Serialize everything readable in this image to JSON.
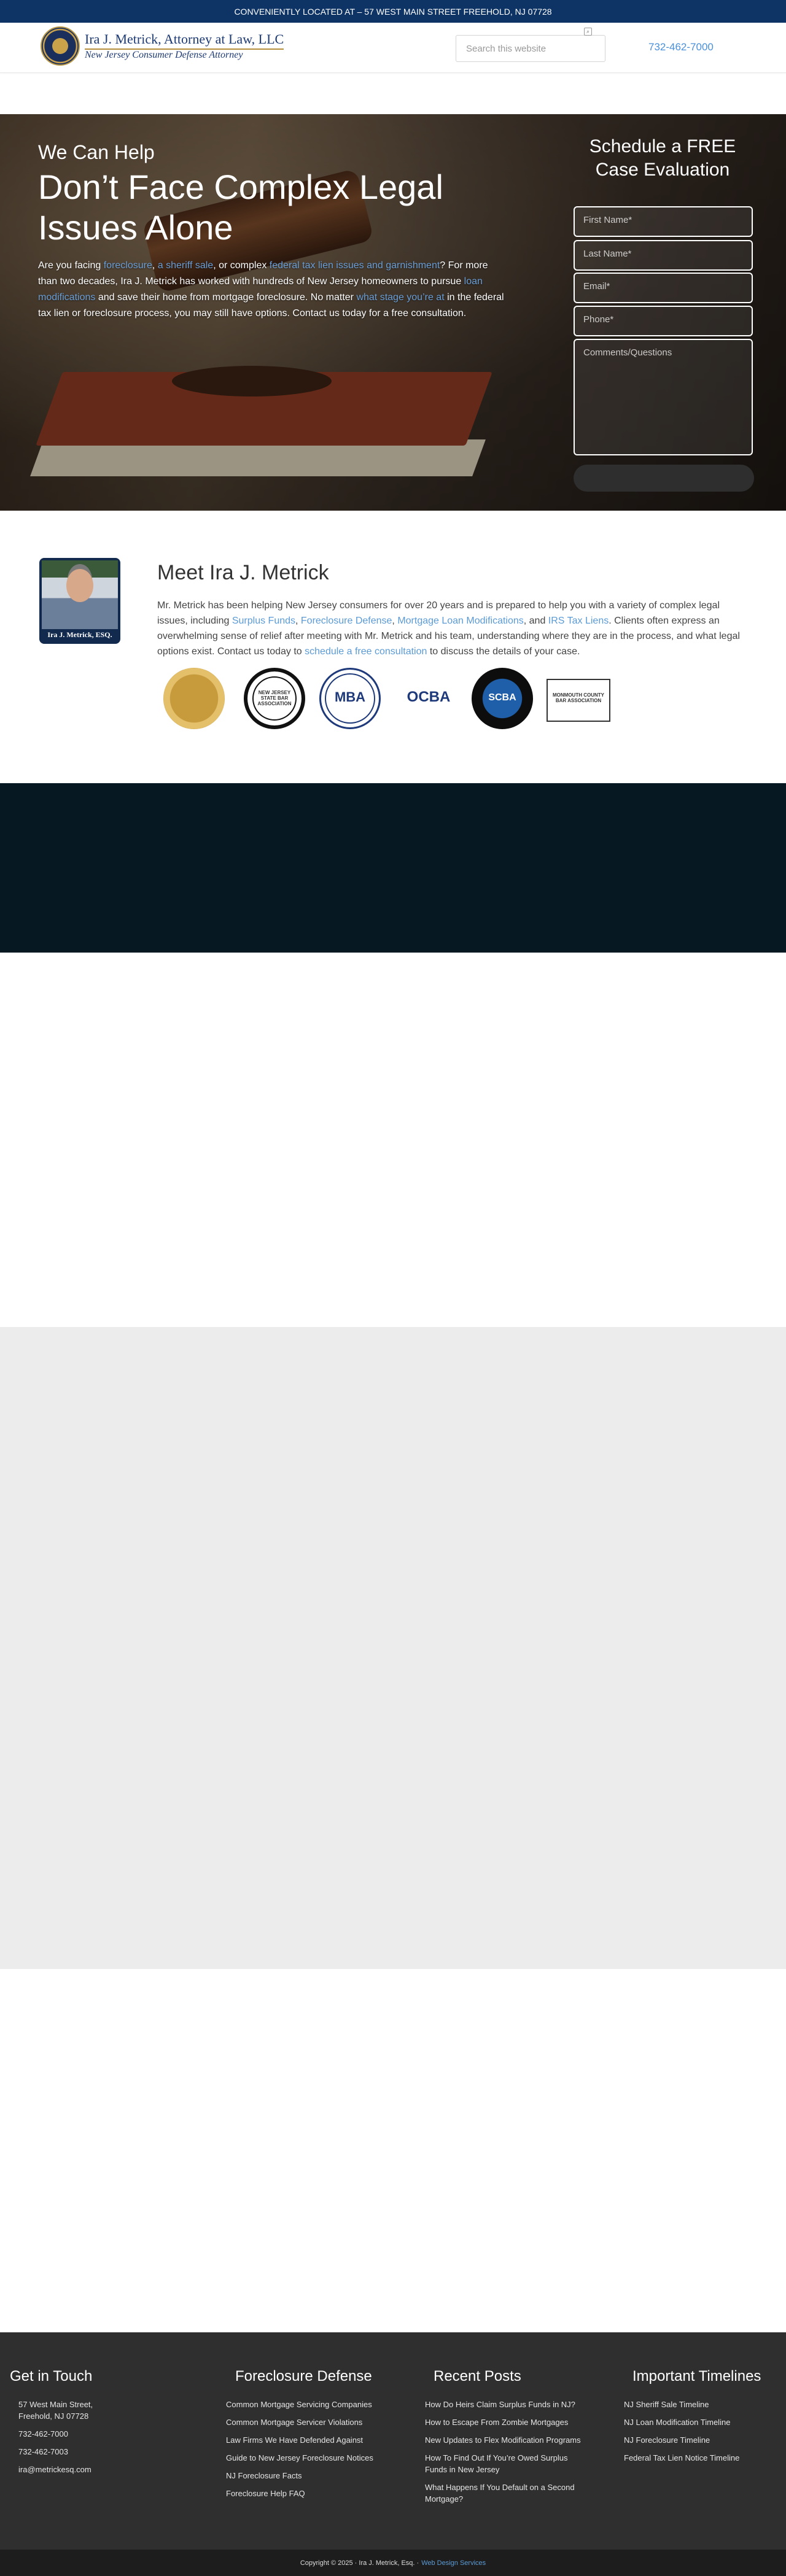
{
  "topbar": {
    "text": "CONVENIENTLY LOCATED AT – 57 WEST MAIN STREET FREEHOLD, NJ 07728"
  },
  "header": {
    "logo_name": "Ira J. Metrick, Attorney at Law, LLC",
    "logo_tagline": "New Jersey Consumer Defense Attorney",
    "search_placeholder": "Search this website",
    "phone": "732-462-7000"
  },
  "hero": {
    "kicker": "We Can Help",
    "title": "Don’t Face Complex Legal Issues Alone",
    "text_1": "Are you facing ",
    "link_1": "foreclosure",
    "text_2": ", ",
    "link_2": "a sheriff sale",
    "text_3": ", or complex ",
    "link_3": "federal tax lien issues and garnishment",
    "text_4": "? For more than two decades, Ira J. Metrick has worked with hundreds of New Jersey homeowners to pursue ",
    "link_4": "loan modifications",
    "text_5": " and save their home from mortgage foreclosure. No matter ",
    "link_5": "what stage you’re at",
    "text_6": " in the federal tax lien or foreclosure process, you may still have options. Contact us today for a free consultation."
  },
  "form": {
    "title": "Schedule a FREE Case Evaluation",
    "first_name": "First Name*",
    "last_name": "Last Name*",
    "email": "Email*",
    "phone": "Phone*",
    "comments": "Comments/Questions"
  },
  "meet": {
    "avatar_caption": "Ira J. Metrick, ESQ.",
    "title": "Meet Ira J. Metrick",
    "text_1": "Mr. Metrick has been helping New Jersey consumers for over 20 years and is prepared to help you with a variety of complex legal issues, including ",
    "link_1": "Surplus Funds",
    "sep_1": ", ",
    "link_2": "Foreclosure Defense",
    "sep_2": ", ",
    "link_3": "Mortgage Loan Modifications",
    "sep_3": ", and ",
    "link_4": "IRS Tax Liens",
    "text_2": ". Clients often express an overwhelming sense of relief after meeting with Mr. Metrick and his team, understanding where they are in the process, and what legal options exist. Contact us today to ",
    "link_5": "schedule a free consultation",
    "text_3": " to discuss the details of your case.",
    "badges": {
      "b2": "NEW JERSEY STATE BAR ASSOCIATION",
      "b3": "MBA",
      "b4": "OCBA",
      "b5": "SCBA",
      "b6": "MONMOUTH COUNTY BAR ASSOCIATION"
    }
  },
  "footer": {
    "col1": {
      "title": "Get in Touch",
      "address": "57 West Main Street, Freehold, NJ 07728",
      "phone1": "732-462-7000",
      "phone2": "732-462-7003",
      "email": "ira@metrickesq.com"
    },
    "col2": {
      "title": "Foreclosure Defense",
      "items": [
        "Common Mortgage Servicing Companies",
        "Common Mortgage Servicer Violations",
        "Law Firms We Have Defended Against",
        "Guide to New Jersey Foreclosure Notices",
        "NJ Foreclosure Facts",
        "Foreclosure Help FAQ"
      ]
    },
    "col3": {
      "title": "Recent Posts",
      "items": [
        "How Do Heirs Claim Surplus Funds in NJ?",
        "How to Escape From Zombie Mortgages",
        "New Updates to Flex Modification Programs",
        "How To Find Out If You’re Owed Surplus Funds in New Jersey",
        "What Happens If You Default on a Second Mortgage?"
      ]
    },
    "col4": {
      "title": "Important Timelines",
      "items": [
        "NJ Sheriff Sale Timeline",
        "NJ Loan Modification Timeline",
        "NJ Foreclosure Timeline",
        "Federal Tax Lien Notice Timeline"
      ]
    }
  },
  "copyright": {
    "text": "Copyright © 2025 · Ira J. Metrick, Esq. ·",
    "link": "Web Design Services"
  }
}
